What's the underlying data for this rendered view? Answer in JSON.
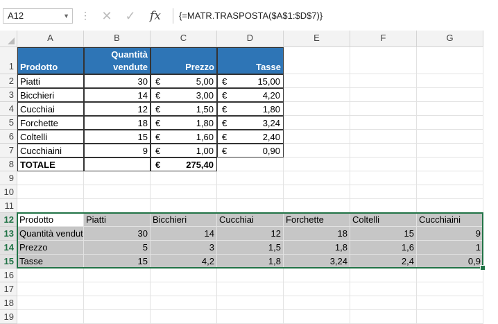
{
  "formula_bar": {
    "name_box": "A12",
    "formula": "{=MATR.TRASPOSTA($A$1:$D$7)}",
    "fx_label": "fx",
    "cancel_glyph": "✕",
    "enter_glyph": "✓"
  },
  "columns": [
    "A",
    "B",
    "C",
    "D",
    "E",
    "F",
    "G"
  ],
  "rows": [
    "1",
    "2",
    "3",
    "4",
    "5",
    "6",
    "7",
    "8",
    "9",
    "10",
    "11",
    "12",
    "13",
    "14",
    "15",
    "16",
    "17",
    "18",
    "19"
  ],
  "table1": {
    "header": [
      "Prodotto",
      "Quantità vendute",
      "Prezzo",
      "Tasse"
    ],
    "header_b_line1": "Quantità",
    "header_b_line2": "vendute",
    "rows": [
      {
        "prodotto": "Piatti",
        "qta": "30",
        "prezzo": "5,00",
        "tasse": "15,00"
      },
      {
        "prodotto": "Bicchieri",
        "qta": "14",
        "prezzo": "3,00",
        "tasse": "4,20"
      },
      {
        "prodotto": "Cucchiai",
        "qta": "12",
        "prezzo": "1,50",
        "tasse": "1,80"
      },
      {
        "prodotto": "Forchette",
        "qta": "18",
        "prezzo": "1,80",
        "tasse": "3,24"
      },
      {
        "prodotto": "Coltelli",
        "qta": "15",
        "prezzo": "1,60",
        "tasse": "2,40"
      },
      {
        "prodotto": "Cucchiaini",
        "qta": "9",
        "prezzo": "1,00",
        "tasse": "0,90"
      }
    ],
    "currency": "€",
    "total_label": "TOTALE",
    "total_value": "275,40"
  },
  "table2": {
    "rows": [
      [
        "Prodotto",
        "Piatti",
        "Bicchieri",
        "Cucchiai",
        "Forchette",
        "Coltelli",
        "Cucchiaini"
      ],
      [
        "Quantità vendute",
        "30",
        "14",
        "12",
        "18",
        "15",
        "9"
      ],
      [
        "Prezzo",
        "5",
        "3",
        "1,5",
        "1,8",
        "1,6",
        "1"
      ],
      [
        "Tasse",
        "15",
        "4,2",
        "1,8",
        "3,24",
        "2,4",
        "0,9"
      ]
    ]
  },
  "colors": {
    "header_blue": "#2e75b6",
    "selection_gray": "#c6c6c6",
    "selection_border": "#217346"
  }
}
